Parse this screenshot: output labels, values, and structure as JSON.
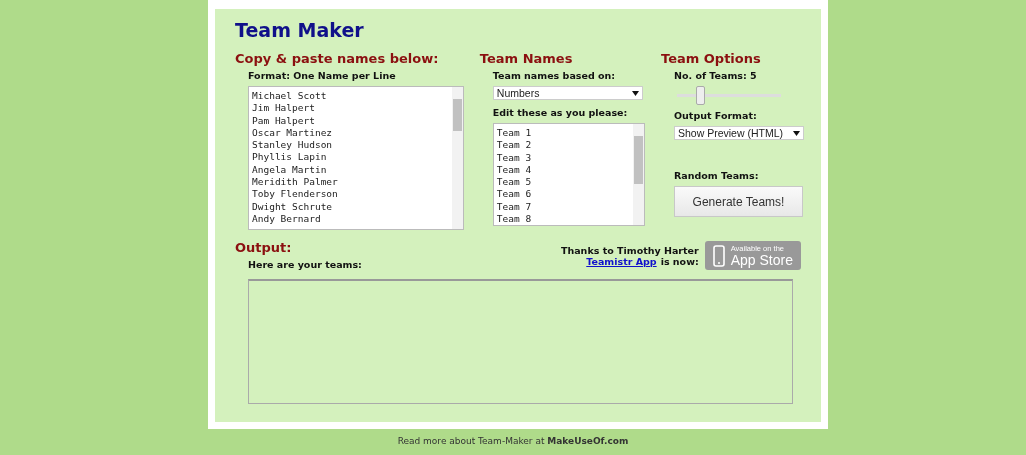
{
  "title": "Team Maker",
  "names_section": {
    "heading": "Copy & paste names below:",
    "format_label": "Format: One Name per Line",
    "names": [
      "Michael Scott",
      "Jim Halpert",
      "Pam Halpert",
      "Oscar Martinez",
      "Stanley Hudson",
      "Phyllis Lapin",
      "Angela Martin",
      "Meridith Palmer",
      "Toby Flenderson",
      "Dwight Schrute",
      "Andy Bernard"
    ]
  },
  "team_names": {
    "heading": "Team Names",
    "based_on_label": "Team names based on:",
    "based_on_value": "Numbers",
    "edit_label": "Edit these as you please:",
    "names": [
      "Team 1",
      "Team 2",
      "Team 3",
      "Team 4",
      "Team 5",
      "Team 6",
      "Team 7",
      "Team 8"
    ]
  },
  "team_options": {
    "heading": "Team Options",
    "teams_label": "No. of Teams: 5",
    "teams_slider": {
      "level": 0.2
    },
    "format_label": "Output Format:",
    "format_value": "Show Preview (HTML)",
    "random_label": "Random Teams:",
    "generate_button": "Generate Teams!"
  },
  "output": {
    "heading": "Output:",
    "label": "Here are your teams:",
    "thanks_line": "Thanks to Timothy Harter",
    "app_link": "Teamistr App",
    "app_suffix": "is now:",
    "badge_small": "Available on the",
    "badge_large": "App Store"
  },
  "footer": {
    "text": "Read more about Team-Maker at",
    "link": "MakeUseOf.com"
  }
}
